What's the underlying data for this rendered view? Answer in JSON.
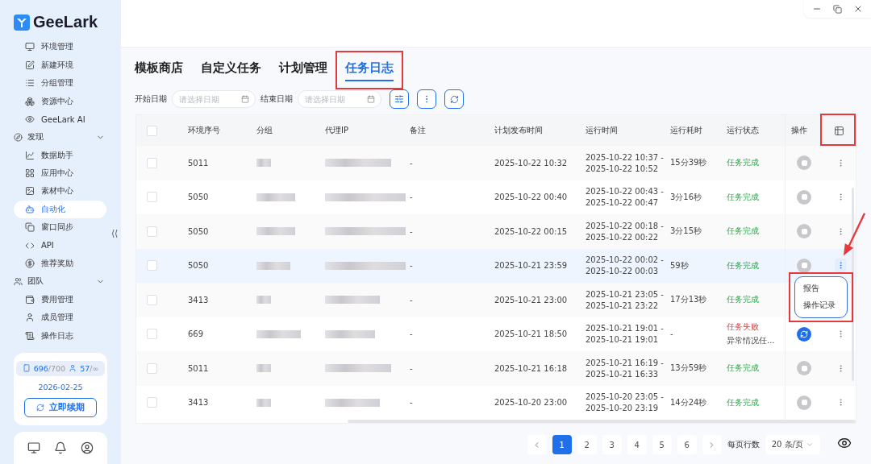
{
  "sidebar": {
    "logo": "GeeLark",
    "items": [
      {
        "label": "环境管理",
        "selected": false
      },
      {
        "label": "新建环境",
        "selected": false
      },
      {
        "label": "分组管理",
        "selected": false
      },
      {
        "label": "资源中心",
        "selected": false
      },
      {
        "label": "GeeLark AI",
        "selected": false
      }
    ],
    "sections": [
      {
        "label": "发现",
        "expanded": true,
        "children": [
          {
            "label": "数据助手",
            "selected": false
          },
          {
            "label": "应用中心",
            "selected": false
          },
          {
            "label": "素材中心",
            "selected": false
          },
          {
            "label": "自动化",
            "selected": true
          },
          {
            "label": "窗口同步",
            "selected": false
          },
          {
            "label": "API",
            "selected": false
          },
          {
            "label": "推荐奖励",
            "selected": false
          }
        ]
      },
      {
        "label": "团队",
        "expanded": true,
        "children": [
          {
            "label": "费用管理",
            "selected": false
          },
          {
            "label": "成员管理",
            "selected": false
          },
          {
            "label": "操作日志",
            "selected": false
          }
        ]
      }
    ],
    "plan": {
      "devices": "696",
      "devices_total": "/700",
      "members": "57",
      "members_total": "/∞",
      "expiry": "2026-02-25",
      "renew_button": "立即续期"
    }
  },
  "tabs": [
    {
      "label": "模板商店",
      "selected": false
    },
    {
      "label": "自定义任务",
      "selected": false
    },
    {
      "label": "计划管理",
      "selected": false
    },
    {
      "label": "任务日志",
      "selected": true
    }
  ],
  "filters": {
    "start_label": "开始日期",
    "start_placeholder": "请选择日期",
    "end_label": "结束日期",
    "end_placeholder": "请选择日期"
  },
  "table": {
    "all_checked": false,
    "columns": [
      "环境序号",
      "分组",
      "代理IP",
      "备注",
      "计划发布时间",
      "运行时间",
      "运行耗时",
      "运行状态",
      "操作"
    ],
    "rows": [
      {
        "env": "5011",
        "note": "-",
        "scheduled": "2025-10-22 10:32",
        "run_start": "2025-10-22 10:37 -",
        "run_end": "2025-10-22 10:52",
        "duration": "15分39秒",
        "status": "任务完成",
        "kind": "done",
        "selected": false,
        "checked": false
      },
      {
        "env": "5050",
        "note": "-",
        "scheduled": "2025-10-22 00:40",
        "run_start": "2025-10-22 00:43 -",
        "run_end": "2025-10-22 00:47",
        "duration": "3分16秒",
        "status": "任务完成",
        "kind": "done",
        "selected": false,
        "checked": false
      },
      {
        "env": "5050",
        "note": "-",
        "scheduled": "2025-10-22 00:15",
        "run_start": "2025-10-22 00:18 -",
        "run_end": "2025-10-22 00:22",
        "duration": "3分15秒",
        "status": "任务完成",
        "kind": "done",
        "selected": false,
        "checked": false
      },
      {
        "env": "5050",
        "note": "-",
        "scheduled": "2025-10-21 23:59",
        "run_start": "2025-10-22 00:02 -",
        "run_end": "2025-10-22 00:03",
        "duration": "59秒",
        "status": "任务完成",
        "kind": "done",
        "selected": true,
        "checked": false,
        "menu": [
          "报告",
          "操作记录"
        ]
      },
      {
        "env": "3413",
        "note": "-",
        "scheduled": "2025-10-21 23:00",
        "run_start": "2025-10-21 23:05 -",
        "run_end": "2025-10-21 23:22",
        "duration": "17分13秒",
        "status": "任务完成",
        "kind": "done",
        "selected": false,
        "checked": false
      },
      {
        "env": "669",
        "note": "-",
        "scheduled": "2025-10-21 18:50",
        "run_start": "2025-10-21 19:01 -",
        "run_end": "2025-10-21 19:01",
        "duration": "-",
        "status": "任务失败",
        "status_detail": "异常情况任...",
        "kind": "failed",
        "selected": false,
        "checked": false
      },
      {
        "env": "5011",
        "note": "-",
        "scheduled": "2025-10-21 16:18",
        "run_start": "2025-10-21 16:19 -",
        "run_end": "2025-10-21 16:33",
        "duration": "13分59秒",
        "status": "任务完成",
        "kind": "done",
        "selected": false,
        "checked": false
      },
      {
        "env": "3413",
        "note": "-",
        "scheduled": "2025-10-20 23:00",
        "run_start": "2025-10-20 23:05 -",
        "run_end": "2025-10-20 23:19",
        "duration": "14分24秒",
        "status": "任务完成",
        "kind": "done",
        "selected": false,
        "checked": false
      }
    ]
  },
  "pagination": {
    "pages": [
      {
        "label": "1",
        "selected": true
      },
      {
        "label": "2",
        "selected": false
      },
      {
        "label": "3",
        "selected": false
      },
      {
        "label": "4",
        "selected": false
      },
      {
        "label": "5",
        "selected": false
      },
      {
        "label": "6",
        "selected": false
      }
    ],
    "rows_label": "每页行数",
    "page_size": "20 条/页"
  }
}
